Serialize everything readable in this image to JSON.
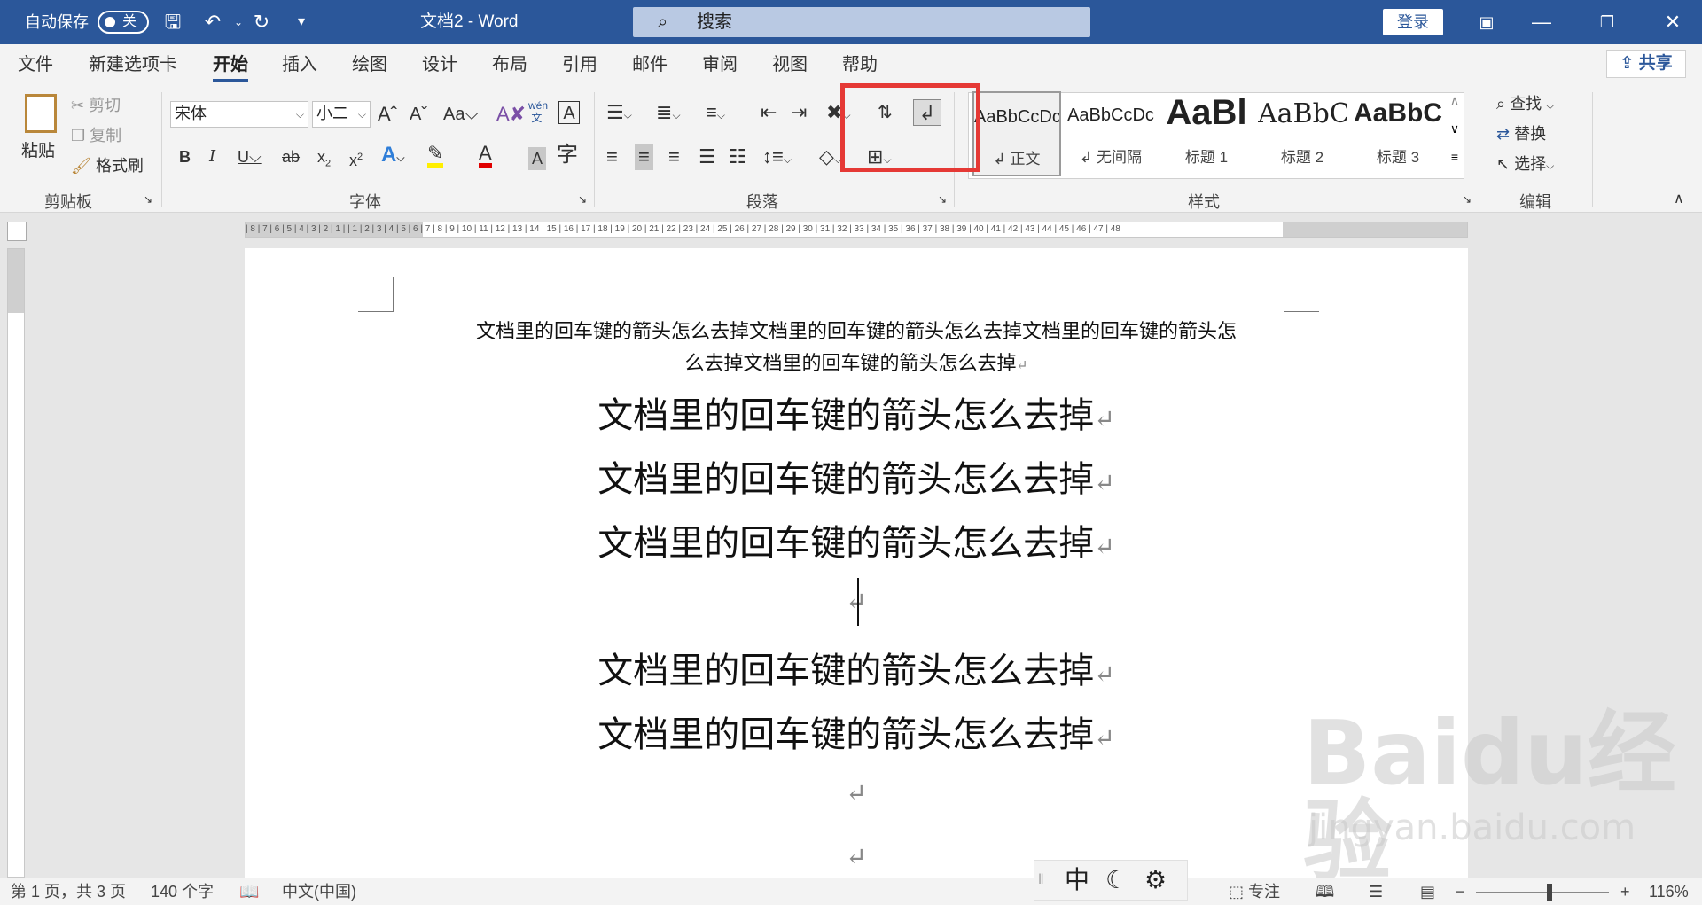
{
  "titlebar": {
    "autosave_label": "自动保存",
    "autosave_state": "关",
    "doc_title": "文档2 - Word",
    "search_placeholder": "搜索",
    "login_label": "登录"
  },
  "tabs": [
    "文件",
    "新建选项卡",
    "开始",
    "插入",
    "绘图",
    "设计",
    "布局",
    "引用",
    "邮件",
    "审阅",
    "视图",
    "帮助"
  ],
  "active_tab": "开始",
  "share_label": "共享",
  "clipboard": {
    "paste": "粘贴",
    "cut": "剪切",
    "copy": "复制",
    "format_painter": "格式刷",
    "group_label": "剪贴板"
  },
  "font": {
    "name": "宋体",
    "size": "小二",
    "group_label": "字体"
  },
  "paragraph": {
    "group_label": "段落"
  },
  "styles": {
    "items": [
      {
        "preview": "AaBbCcDc",
        "name": "↲ 正文"
      },
      {
        "preview": "AaBbCcDc",
        "name": "↲ 无间隔"
      },
      {
        "preview": "AaBl",
        "name": "标题 1"
      },
      {
        "preview": "AaBbC",
        "name": "标题 2"
      },
      {
        "preview": "AaBbC",
        "name": "标题 3"
      }
    ],
    "group_label": "样式"
  },
  "editing": {
    "find": "查找",
    "replace": "替换",
    "select": "选择",
    "group_label": "编辑"
  },
  "ruler_h_text": "| 8 | 7 | 6 | 5 | 4 | 3 | 2 | 1 |   | 1 | 2 | 3 | 4 | 5 | 6 | 7 | 8 | 9 | 10 | 11 | 12 | 13 | 14 | 15 | 16 | 17 | 18 | 19 | 20 | 21 | 22 | 23 | 24 | 25 | 26 | 27 | 28 | 29 | 30 | 31 | 32 | 33 | 34 | 35 | 36 | 37 | 38 | 39 | 40 | 41 | 42 | 43 | 44 | 45 | 46 | 47 | 48",
  "document": {
    "small_line_1": "文档里的回车键的箭头怎么去掉文档里的回车键的箭头怎么去掉文档里的回车键的箭头怎",
    "small_line_2": "么去掉文档里的回车键的箭头怎么去掉",
    "big_line": "文档里的回车键的箭头怎么去掉",
    "return_mark": "↵"
  },
  "statusbar": {
    "page": "第 1 页，共 3 页",
    "words": "140 个字",
    "language": "中文(中国)",
    "focus": "专注",
    "zoom": "116%",
    "ime_mode": "中"
  },
  "watermark": {
    "brand": "Baidu经验",
    "url": "jingyan.baidu.com"
  },
  "colors": {
    "titlebar": "#2b579a",
    "highlight_box": "#e53935"
  }
}
